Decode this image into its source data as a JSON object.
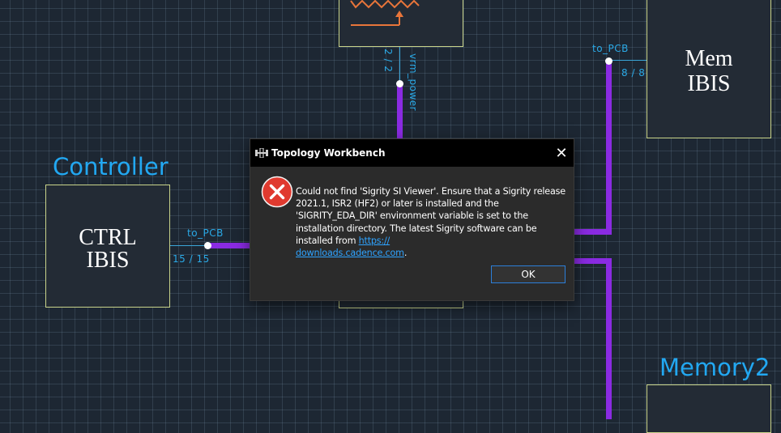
{
  "canvas": {
    "blocks": {
      "ctrl": {
        "title": "Controller",
        "label_line1": "CTRL",
        "label_line2": "IBIS",
        "pin_name": "to_PCB",
        "pin_count": "15 / 15"
      },
      "mem": {
        "label_line1": "Mem",
        "label_line2": "IBIS",
        "pin_name": "to_PCB",
        "pin_count": "8 / 8"
      },
      "vrm": {
        "pin_name": "vrm_power",
        "pin_count": "2 / 2"
      },
      "memory2": {
        "title": "Memory2"
      }
    },
    "colors": {
      "grid_bg": "#1d2733",
      "wire": "#8a2be2",
      "title": "#22a8f2",
      "block_border": "#c9d48a"
    }
  },
  "dialog": {
    "title": "Topology Workbench",
    "icon": "error-icon",
    "message": "Could not find 'Sigrity SI Viewer'. Ensure that a Sigrity release 2021.1, ISR2 (HF2) or later is installed and the 'SIGRITY_EDA_DIR' environment variable is set to the installation directory. The latest Sigrity software can be installed from ",
    "link_part1": "https://",
    "link_part2": "downloads.cadence.com",
    "message_end": ".",
    "ok_label": "OK",
    "close_glyph": "✕"
  }
}
